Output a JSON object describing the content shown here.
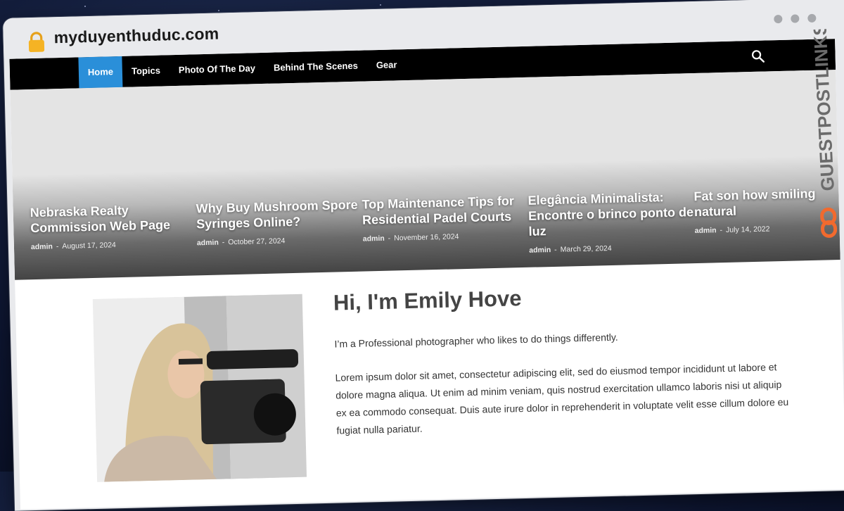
{
  "browser": {
    "domain": "myduyenthuduc.com",
    "lock_icon": "lock-icon",
    "window_dots": 3
  },
  "nav": {
    "items": [
      {
        "label": "Home",
        "active": true
      },
      {
        "label": "Topics",
        "active": false
      },
      {
        "label": "Photo Of The Day",
        "active": false
      },
      {
        "label": "Behind The Scenes",
        "active": false
      },
      {
        "label": "Gear",
        "active": false
      }
    ],
    "search_icon": "search-icon",
    "active_color": "#2a8fd9"
  },
  "slides": [
    {
      "title": "Nebraska Realty Commission Web Page",
      "author": "admin",
      "date": "August 17, 2024"
    },
    {
      "title": "Why Buy Mushroom Spore Syringes Online?",
      "author": "admin",
      "date": "October 27, 2024"
    },
    {
      "title": "Top Maintenance Tips for Residential Padel Courts",
      "author": "admin",
      "date": "November 16, 2024"
    },
    {
      "title": "Elegância Minimalista: Encontre o brinco ponto de luz",
      "author": "admin",
      "date": "March 29, 2024"
    },
    {
      "title": "Fat son how smiling natural",
      "author": "admin",
      "date": "July 14, 2022"
    }
  ],
  "about": {
    "heading": "Hi, I'm Emily Hove",
    "intro": "I’m a Professional photographer who likes to do things differently.",
    "body": "Lorem ipsum dolor sit amet, consectetur adipiscing elit, sed do eiusmod tempor incididunt ut labore et dolore magna aliqua. Ut enim ad minim veniam, quis nostrud exercitation ullamco laboris nisi ut aliquip ex ea commodo consequat. Duis aute irure dolor in reprehenderit in voluptate velit esse cillum dolore eu fugiat nulla pariatur."
  },
  "watermark": {
    "text": "GUESTPOSTLINKS",
    "accent": "#f26a2e"
  }
}
